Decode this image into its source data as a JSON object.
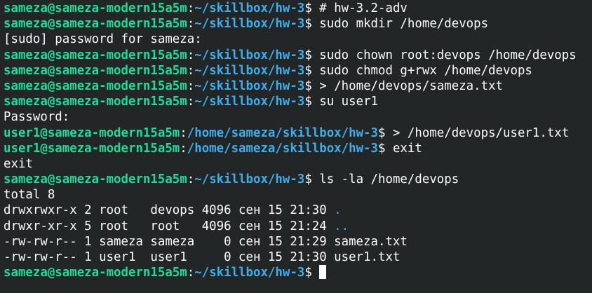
{
  "colors": {
    "background": "#232627",
    "prompt_user": "#1cdc9a",
    "prompt_path": "#3daee9",
    "text": "#fcfcfc",
    "directory": "#3daee9"
  },
  "terminal": {
    "lines": [
      {
        "user": "sameza@sameza-modern15a5m",
        "path": "~/skillbox/hw-3",
        "cmd": "# hw-3.2-adv"
      },
      {
        "user": "sameza@sameza-modern15a5m",
        "path": "~/skillbox/hw-3",
        "cmd": "sudo mkdir /home/devops"
      },
      {
        "text": "[sudo] password for sameza:"
      },
      {
        "user": "sameza@sameza-modern15a5m",
        "path": "~/skillbox/hw-3",
        "cmd": "sudo chown root:devops /home/devops"
      },
      {
        "user": "sameza@sameza-modern15a5m",
        "path": "~/skillbox/hw-3",
        "cmd": "sudo chmod g+rwx /home/devops"
      },
      {
        "user": "sameza@sameza-modern15a5m",
        "path": "~/skillbox/hw-3",
        "cmd": "> /home/devops/sameza.txt"
      },
      {
        "user": "sameza@sameza-modern15a5m",
        "path": "~/skillbox/hw-3",
        "cmd": "su user1"
      },
      {
        "text": "Password:"
      },
      {
        "user": "user1@sameza-modern15a5m",
        "path": "/home/sameza/skillbox/hw-3",
        "cmd": "> /home/devops/user1.txt"
      },
      {
        "user": "user1@sameza-modern15a5m",
        "path": "/home/sameza/skillbox/hw-3",
        "cmd": "exit"
      },
      {
        "text": "exit"
      },
      {
        "user": "sameza@sameza-modern15a5m",
        "path": "~/skillbox/hw-3",
        "cmd": "ls -la /home/devops"
      },
      {
        "text": "total 8"
      },
      {
        "text": "drwxrwxr-x 2 root   devops 4096 сен 15 21:30 ",
        "dir": "."
      },
      {
        "text": "drwxr-xr-x 5 root   root   4096 сен 15 21:24 ",
        "dir": ".."
      },
      {
        "text": "-rw-rw-r-- 1 sameza sameza    0 сен 15 21:29 sameza.txt"
      },
      {
        "text": "-rw-rw-r-- 1 user1  user1     0 сен 15 21:30 user1.txt"
      },
      {
        "user": "sameza@sameza-modern15a5m",
        "path": "~/skillbox/hw-3",
        "cmd": "",
        "cursor": true
      }
    ]
  }
}
